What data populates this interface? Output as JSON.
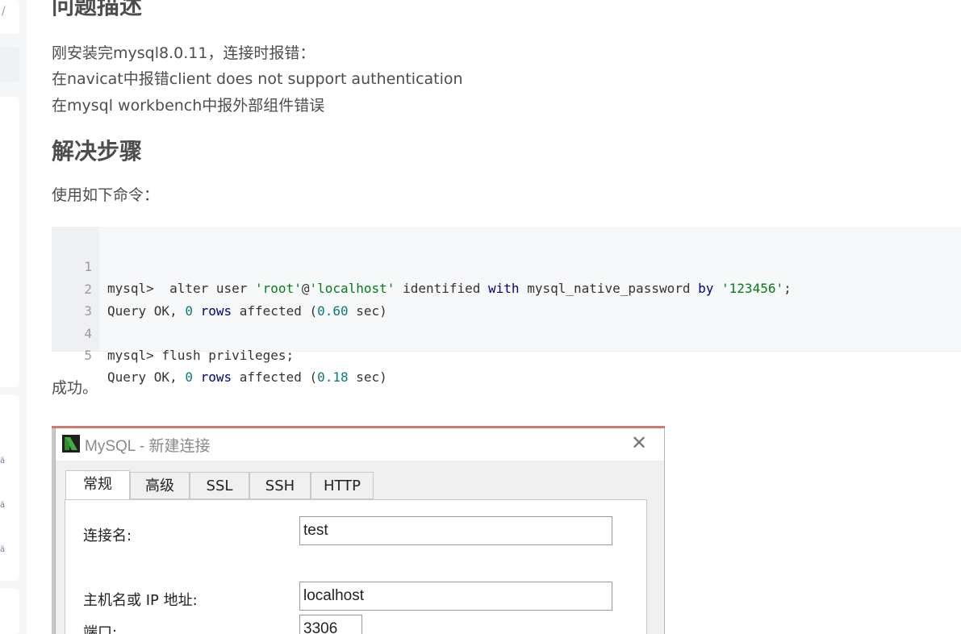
{
  "article": {
    "heading_problem": "问题描述",
    "problem_lines": [
      "刚安装完mysql8.0.11，连接时报错：",
      "在navicat中报错client does not support authentication",
      "在mysql workbench中报外部组件错误"
    ],
    "heading_solution": "解决步骤",
    "use_commands": "使用如下命令：",
    "success": "成功。"
  },
  "code": {
    "line_numbers": [
      "1",
      "2",
      "3",
      "4",
      "5"
    ],
    "l1": {
      "prompt": "mysql>  alter user ",
      "s1": "'root'",
      "at": "@",
      "s2": "'localhost'",
      "mid": " identified ",
      "kw1": "with",
      "mid2": " mysql_native_password ",
      "kw2": "by",
      "sp": " ",
      "s3": "'123456'",
      "end": ";"
    },
    "l2": {
      "a": "Query OK, ",
      "n1": "0",
      "sp": " ",
      "kw": "rows",
      "b": " affected (",
      "n2": "0.60",
      "c": " sec)"
    },
    "l4": {
      "text": "mysql> flush privileges;"
    },
    "l5": {
      "a": "Query OK, ",
      "n1": "0",
      "sp": " ",
      "kw": "rows",
      "b": " affected (",
      "n2": "0.18",
      "c": " sec)"
    }
  },
  "dialog": {
    "title": "MySQL - 新建连接",
    "close_glyph": "✕",
    "tabs": [
      "常规",
      "高级",
      "SSL",
      "SSH",
      "HTTP"
    ],
    "active_tab": "常规",
    "fields": {
      "conn_name_label": "连接名:",
      "conn_name_value": "test",
      "host_label": "主机名或 IP 地址:",
      "host_value": "localhost",
      "port_label": "端口:",
      "port_value": "3306"
    },
    "logo_icon": "navicat-logo-icon"
  },
  "colors": {
    "heading": "#4d4d4d",
    "string": "#067d17",
    "keyword": "#000080",
    "number": "#0b7a7a",
    "navicat_green": "#2e8b2e"
  }
}
